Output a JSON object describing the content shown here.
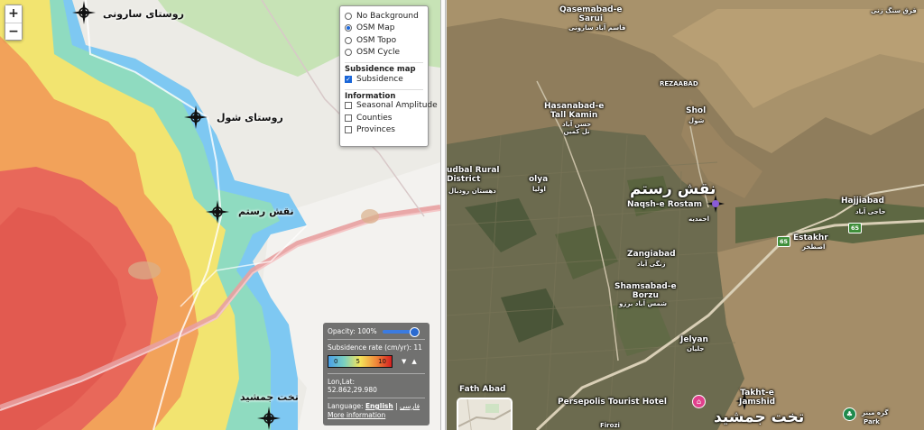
{
  "left_map": {
    "zoom": {
      "in_label": "+",
      "out_label": "−"
    },
    "layer_panel": {
      "base_layers": [
        {
          "label": "No Background",
          "selected": false
        },
        {
          "label": "OSM Map",
          "selected": true
        },
        {
          "label": "OSM Topo",
          "selected": false
        },
        {
          "label": "OSM Cycle",
          "selected": false
        }
      ],
      "subsidence_title": "Subsidence map",
      "subsidence_layer": {
        "label": "Subsidence",
        "checked": true
      },
      "information_title": "Information",
      "info_layers": [
        {
          "label": "Seasonal Amplitude",
          "checked": false
        },
        {
          "label": "Counties",
          "checked": false
        },
        {
          "label": "Provinces",
          "checked": false
        }
      ]
    },
    "info_box": {
      "opacity_label": "Opacity: 100%",
      "opacity_value": 1.0,
      "rate_label": "Subsidence rate (cm/yr): 11",
      "legend_ticks": [
        "0",
        "5",
        "10"
      ],
      "lonlat_label": "Lon,Lat:",
      "lonlat_value": "52.862,29.980",
      "language_label": "Language:",
      "lang_english": "English",
      "lang_separator": "|",
      "lang_farsi": "فارسی",
      "more_info": "More information"
    },
    "place_labels": {
      "saruni": "روستای سارونی",
      "shol": "روستای شول",
      "naqsh": "نقش رستم",
      "takht": "تخت جمشید"
    },
    "colors": {
      "subsidence_high": "#e8685a",
      "subsidence_mid": "#f4e466",
      "subsidence_low": "#7fd6c8",
      "subsidence_edge": "#6db5f0"
    }
  },
  "right_map": {
    "labels": {
      "qasemabad": "Qasemabad-e\nSarui",
      "qasemabad_fa": "قاسم آباد سارونی",
      "hasanabad": "Hasanabad-e\nTall Kamin",
      "hasanabad_fa": "حسن آباد\nتل کمین",
      "rezaabad": "REZAABAD",
      "shol": "Shol",
      "shol_fa": "شول",
      "dudbal": "udbal Rural\nDistrict",
      "dudbal_fa": "دهستان رودبال",
      "olya": "olya",
      "olya_fa": "اولیا",
      "naqsh_fa_big": "نقش رستم",
      "naqsh_en": "Naqsh-e Rostam",
      "naqsh_fa_small": "احمدیه",
      "hajjiabad": "Hajjiabad",
      "hajjiabad_fa": "حاجی آباد",
      "estakhr": "Estakhr",
      "estakhr_fa": "اصطخر",
      "zangiabad": "Zangiabad",
      "zangiabad_fa": "زنگی آباد",
      "shamsabad": "Shamsabad-e\nBorzu",
      "shamsabad_fa": "شمس آباد برزو",
      "jelyan": "Jelyan",
      "jelyan_fa": "جلیان",
      "fathabad": "Fath Abad",
      "persepolis_hotel": "Persepolis Tourist Hotel",
      "takht_en": "Takht-e\nJamshid",
      "takht_fa_big": "تخت جمشید",
      "firozi": "Firozi",
      "park_fa": "گره مینر",
      "park_en": "Park",
      "top_right_fa": "قرق سنگ زنی"
    },
    "road_shield": "65",
    "road_shield_2": "65"
  }
}
